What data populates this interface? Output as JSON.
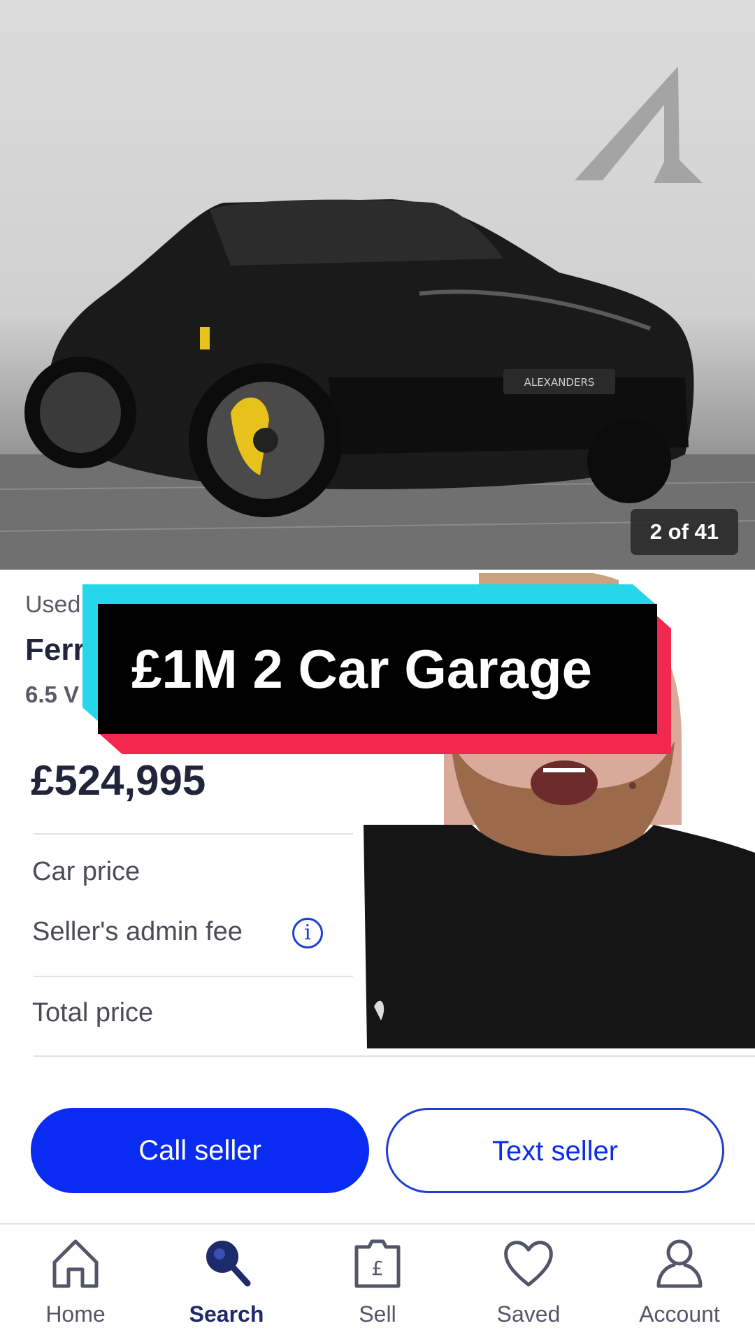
{
  "gallery": {
    "counter": "2 of 41"
  },
  "listing": {
    "condition_label": "Used",
    "make_label": "Ferr",
    "spec_label": "6.5 V",
    "price": "£524,995",
    "rows": [
      "Car price",
      "Seller's admin fee",
      "Total price"
    ]
  },
  "overlay": {
    "caption": "£1M 2 Car Garage"
  },
  "actions": {
    "call_label": "Call seller",
    "text_label": "Text seller"
  },
  "nav": [
    {
      "label": "Home",
      "icon": "home-icon"
    },
    {
      "label": "Search",
      "icon": "search-icon",
      "active": true
    },
    {
      "label": "Sell",
      "icon": "sell-tag-icon"
    },
    {
      "label": "Saved",
      "icon": "heart-icon"
    },
    {
      "label": "Account",
      "icon": "account-icon"
    }
  ],
  "colors": {
    "accent": "#0a2cf2",
    "caption_cyan": "#26d6ea",
    "caption_red": "#f4284e"
  }
}
